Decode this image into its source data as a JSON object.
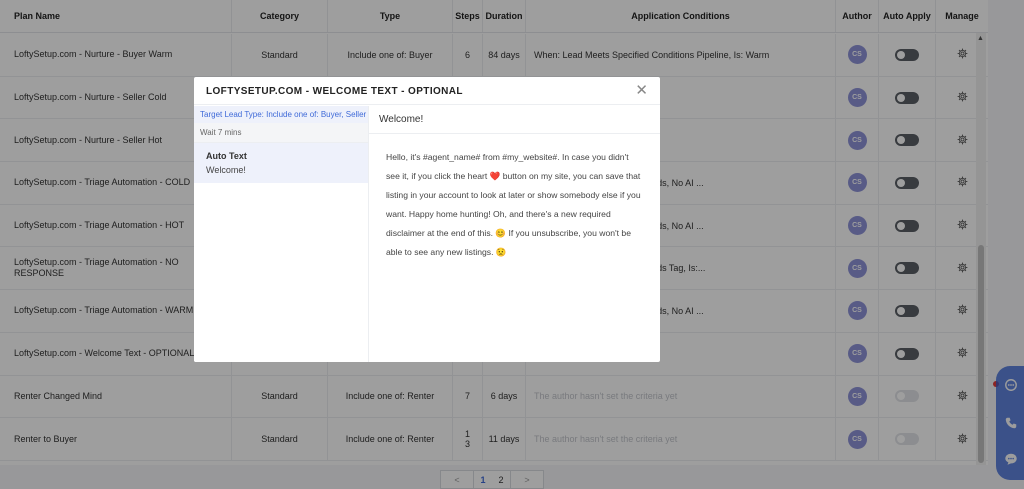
{
  "table": {
    "headers": {
      "name": "Plan Name",
      "category": "Category",
      "type": "Type",
      "steps": "Steps",
      "duration": "Duration",
      "conditions": "Application Conditions",
      "author": "Author",
      "auto_apply": "Auto Apply",
      "manage": "Manage"
    },
    "rows": [
      {
        "name": "LoftySetup.com - Nurture - Buyer Warm",
        "category": "Standard",
        "type": "Include one of: Buyer",
        "steps": "6",
        "duration": "84 days",
        "conditions": "When: Lead Meets Specified Conditions Pipeline, Is: Warm",
        "author": "CS"
      },
      {
        "name": "LoftySetup.com - Nurture - Seller Cold",
        "category": "",
        "type": "",
        "steps": "",
        "duration": "",
        "conditions": "onditions Pipeline, Is: Cold",
        "author": "CS"
      },
      {
        "name": "LoftySetup.com - Nurture - Seller Hot",
        "category": "",
        "type": "",
        "steps": "",
        "duration": "",
        "conditions": "onditions Pipeline, Is: Hot",
        "author": "CS"
      },
      {
        "name": "LoftySetup.com - Triage Automation - COLD",
        "category": "",
        "type": "",
        "steps": "",
        "duration": "",
        "conditions": "onditions Pipeline, Is: New Leads, No AI ...",
        "author": "CS"
      },
      {
        "name": "LoftySetup.com - Triage Automation - HOT",
        "category": "",
        "type": "",
        "steps": "",
        "duration": "",
        "conditions": "onditions Pipeline, Is: New Leads, No AI ...",
        "author": "CS"
      },
      {
        "name": "LoftySetup.com - Triage Automation - NO RESPONSE",
        "category": "",
        "type": "",
        "steps": "",
        "duration": "",
        "conditions": "onditions Pipeline, Is: New Leads Tag, Is:...",
        "author": "CS"
      },
      {
        "name": "LoftySetup.com - Triage Automation - WARM",
        "category": "",
        "type": "",
        "steps": "",
        "duration": "",
        "conditions": "onditions Pipeline, Is: New Leads, No AI ...",
        "author": "CS"
      },
      {
        "name": "LoftySetup.com - Welcome Text - OPTIONAL",
        "category": "",
        "type": "",
        "steps": "",
        "duration": "",
        "conditions": ": New Leads",
        "author": "CS"
      },
      {
        "name": "Renter Changed Mind",
        "category": "Standard",
        "type": "Include one of: Renter",
        "steps": "7",
        "duration": "6 days",
        "conditions": "The author hasn't set the criteria yet",
        "author": "CS"
      },
      {
        "name": "Renter to Buyer",
        "category": "Standard",
        "type": "Include one of: Renter",
        "steps": "13",
        "duration": "11 days",
        "conditions": "The author hasn't set the criteria yet",
        "author": "CS"
      }
    ]
  },
  "pagination": {
    "prev": "<",
    "pages": [
      "1",
      "2"
    ],
    "current": "1",
    "next": ">"
  },
  "modal": {
    "title": "LOFTYSETUP.COM - WELCOME TEXT - OPTIONAL",
    "close": "✕",
    "target_type": "Target Lead Type: Include one of: Buyer, Seller",
    "wait": "Wait 7 mins",
    "step_title": "Auto Text",
    "step_preview": "Welcome!",
    "subject": "Welcome!",
    "message": "Hello, it's #agent_name# from #my_website#. In case you didn't see it, if you click the heart ❤️ button on my site, you can save that listing in your account to look at later or show somebody else if you want. Happy home hunting! Oh, and there's a new required disclaimer at the end of this. 😊 If you unsubscribe, you won't be able to see any new listings. 😟"
  },
  "colors": {
    "accent": "#3f6ad8",
    "avatar": "#8f93d8",
    "widget": "#2f5fd6"
  }
}
